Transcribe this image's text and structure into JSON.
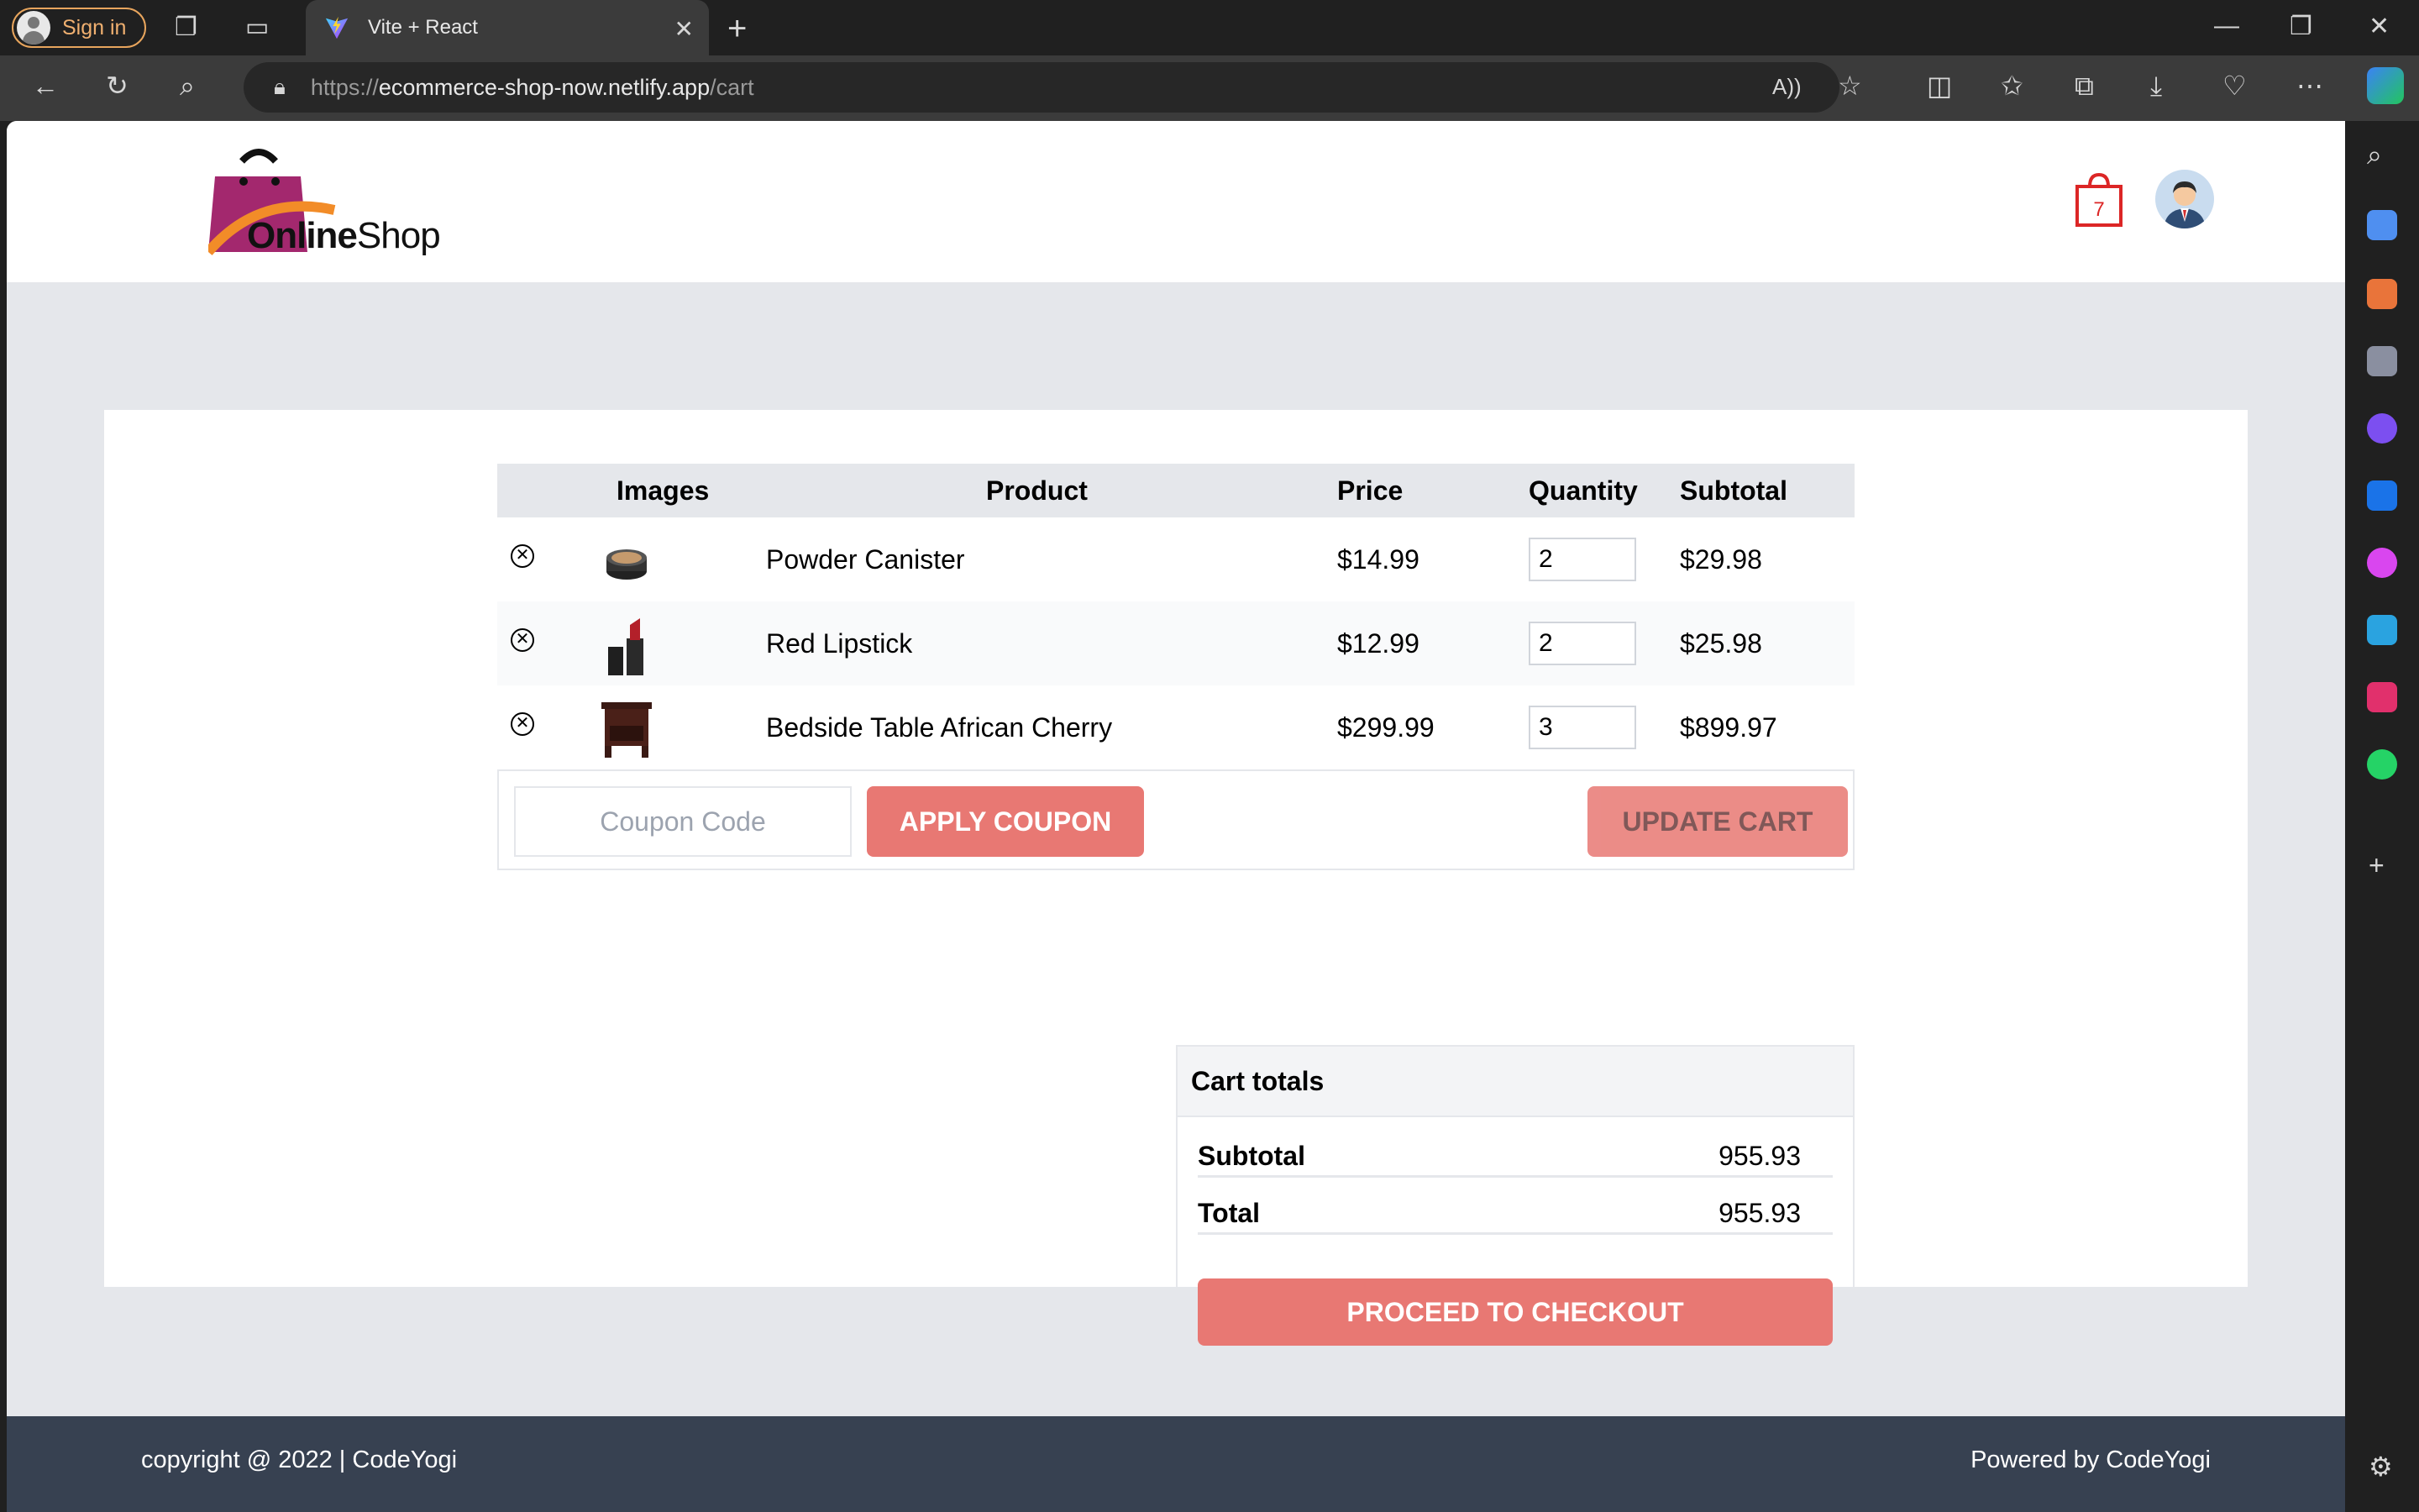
{
  "browser": {
    "signin_label": "Sign in",
    "tab_title": "Vite + React",
    "url_scheme": "https://",
    "url_host": "ecommerce-shop-now.netlify.app",
    "url_path": "/cart"
  },
  "header": {
    "logo_bold": "Online",
    "logo_light": "Shop",
    "cart_count": "7"
  },
  "table": {
    "headers": {
      "images": "Images",
      "product": "Product",
      "price": "Price",
      "quantity": "Quantity",
      "subtotal": "Subtotal"
    },
    "rows": [
      {
        "name": "Powder Canister",
        "price": "$14.99",
        "qty": "2",
        "subtotal": "$29.98"
      },
      {
        "name": "Red Lipstick",
        "price": "$12.99",
        "qty": "2",
        "subtotal": "$25.98"
      },
      {
        "name": "Bedside Table African Cherry",
        "price": "$299.99",
        "qty": "3",
        "subtotal": "$899.97"
      }
    ]
  },
  "coupon": {
    "placeholder": "Coupon Code",
    "apply_label": "APPLY COUPON",
    "update_label": "UPDATE CART"
  },
  "totals": {
    "title": "Cart totals",
    "subtotal_label": "Subtotal",
    "subtotal_value": "955.93",
    "total_label": "Total",
    "total_value": "955.93",
    "checkout_label": "PROCEED TO CHECKOUT"
  },
  "footer": {
    "left": "copyright @ 2022 | CodeYogi",
    "right": "Powered by CodeYogi"
  },
  "colors": {
    "accent": "#e87873",
    "footer_bg": "#374151",
    "page_bg": "#e5e7eb"
  }
}
